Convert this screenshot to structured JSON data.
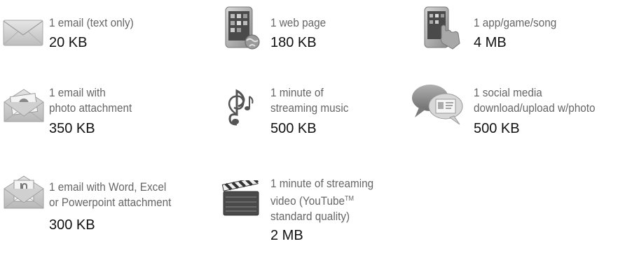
{
  "items": [
    {
      "id": "email-text",
      "lines": [
        "1 email (text only)"
      ],
      "size": "20 KB",
      "icon": "envelope-icon"
    },
    {
      "id": "web-page",
      "lines": [
        "1 web page"
      ],
      "size": "180 KB",
      "icon": "phone-globe-icon"
    },
    {
      "id": "app-game-song",
      "lines": [
        "1 app/game/song"
      ],
      "size": "4 MB",
      "icon": "phone-hand-icon"
    },
    {
      "id": "email-photo",
      "lines": [
        "1 email with",
        "photo attachment"
      ],
      "size": "350 KB",
      "icon": "envelope-photo-icon"
    },
    {
      "id": "streaming-music",
      "lines": [
        "1 minute of",
        "streaming music"
      ],
      "size": "500 KB",
      "icon": "music-notes-icon"
    },
    {
      "id": "social-media",
      "lines": [
        "1 social media",
        "download/upload w/photo"
      ],
      "size": "500 KB",
      "icon": "speech-bubbles-icon"
    },
    {
      "id": "email-office",
      "lines": [
        "1 email with Word, Excel",
        "or Powerpoint attachment"
      ],
      "size": "300 KB",
      "icon": "envelope-clip-icon"
    },
    {
      "id": "streaming-video",
      "lines": [
        "1 minute of streaming",
        "video (YouTube",
        "standard quality)"
      ],
      "tm": "TM",
      "size": "2 MB",
      "icon": "clapperboard-icon"
    }
  ]
}
